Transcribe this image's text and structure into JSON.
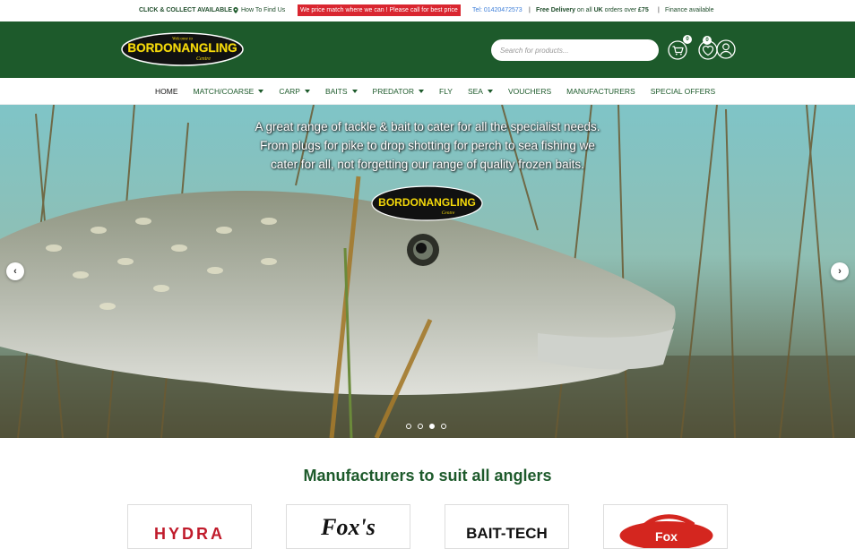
{
  "topbar": {
    "collect": "CLICK & COLLECT AVAILABLE",
    "find_us": "How To Find Us",
    "price_match": "We price match where we can ! Please call for best price",
    "tel": "Tel: 01420472573",
    "separator": "|",
    "delivery_prefix": "Free Delivery",
    "delivery_middle": " on all ",
    "delivery_uk": "UK",
    "delivery_suffix": " orders over ",
    "delivery_amount": "£75",
    "finance": "Finance available"
  },
  "header": {
    "logo_main": "BORDONANGLING",
    "logo_sub": "Centre",
    "logo_welcome": "Welcome to",
    "search_placeholder": "Search for products...",
    "cart_count": "0",
    "wishlist_count": "0"
  },
  "nav": {
    "items": [
      {
        "label": "HOME",
        "dropdown": false
      },
      {
        "label": "MATCH/COARSE",
        "dropdown": true
      },
      {
        "label": "CARP",
        "dropdown": true
      },
      {
        "label": "BAITS",
        "dropdown": true
      },
      {
        "label": "PREDATOR",
        "dropdown": true
      },
      {
        "label": "FLY",
        "dropdown": false
      },
      {
        "label": "SEA",
        "dropdown": true
      },
      {
        "label": "VOUCHERS",
        "dropdown": false
      },
      {
        "label": "MANUFACTURERS",
        "dropdown": false
      },
      {
        "label": "SPECIAL OFFERS",
        "dropdown": false
      }
    ]
  },
  "hero": {
    "line1": "A great range of tackle & bait to cater for all the specialist needs.",
    "line2": "From plugs for pike to drop shotting for perch to sea fishing we",
    "line3": "cater for all, not forgetting our range of quality frozen baits.",
    "logo_main": "BORDONANGLING",
    "logo_sub": "Centre",
    "prev_arrow": "‹",
    "next_arrow": "›",
    "slide_count": 4,
    "active_slide": 3
  },
  "manufacturers": {
    "title": "Manufacturers to suit all anglers",
    "brands": [
      "HYDRA",
      "Fox's",
      "BAIT-TECH",
      "Fox"
    ]
  },
  "colors": {
    "brand_green": "#1d5a2b",
    "price_red": "#d92630",
    "tel_blue": "#3b7dd8",
    "logo_yellow": "#f5d90a"
  }
}
